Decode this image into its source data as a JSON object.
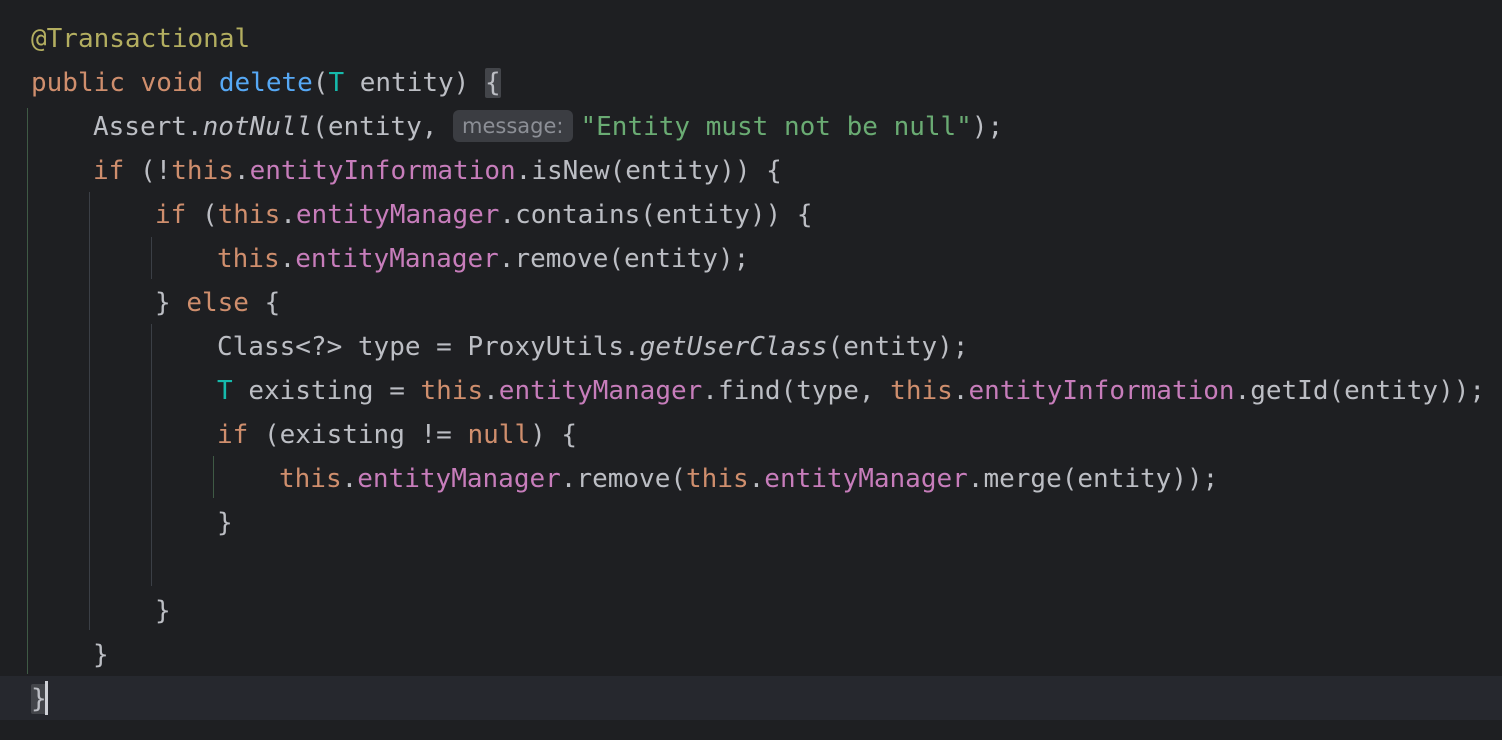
{
  "code": {
    "annotation": "@Transactional",
    "kw_public": "public",
    "kw_void": "void",
    "method_name": "delete",
    "type_T": "T",
    "param_entity": "entity",
    "assert_class": "Assert",
    "assert_method": "notNull",
    "hint_message": "message:",
    "assert_string": "\"Entity must not be null\"",
    "kw_if": "if",
    "kw_this": "this",
    "kw_else": "else",
    "kw_null": "null",
    "field_entityInformation": "entityInformation",
    "field_entityManager": "entityManager",
    "method_isNew": "isNew",
    "method_contains": "contains",
    "method_remove": "remove",
    "method_find": "find",
    "method_getId": "getId",
    "method_merge": "merge",
    "class_Class": "Class<?>",
    "var_type": "type",
    "proxy_class": "ProxyUtils",
    "proxy_method": "getUserClass",
    "var_existing": "existing"
  }
}
